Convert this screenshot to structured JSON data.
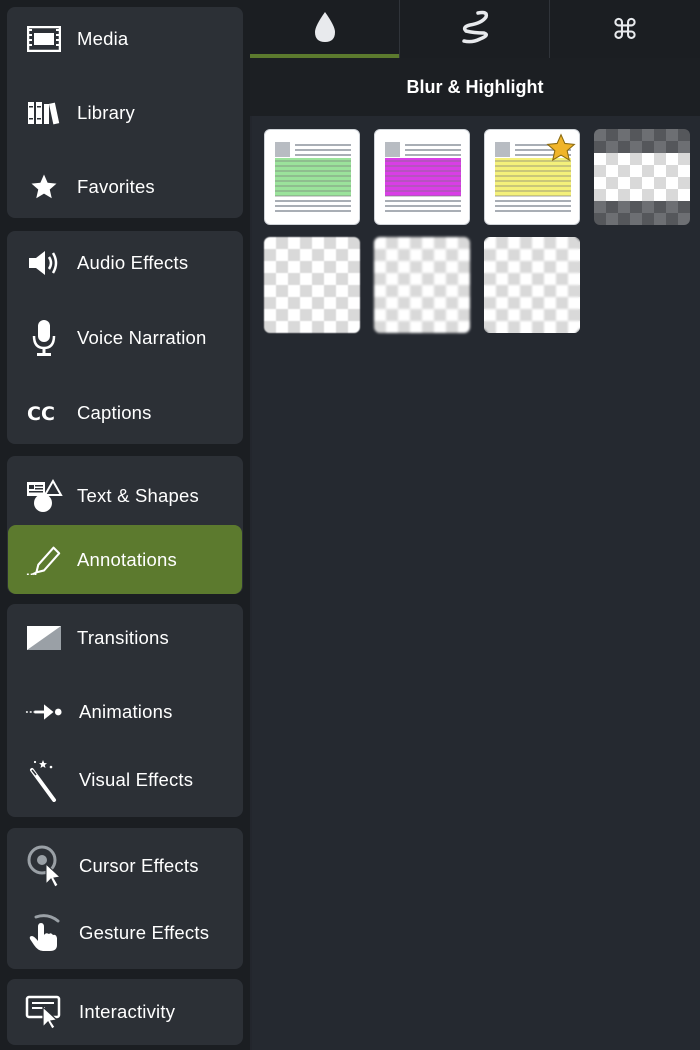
{
  "sidebar": {
    "items": [
      {
        "label": "Media",
        "icon": "film-strip-icon"
      },
      {
        "label": "Library",
        "icon": "books-icon"
      },
      {
        "label": "Favorites",
        "icon": "star-icon"
      },
      {
        "label": "Audio Effects",
        "icon": "speaker-icon"
      },
      {
        "label": "Voice Narration",
        "icon": "microphone-icon"
      },
      {
        "label": "Captions",
        "icon": "cc-icon"
      },
      {
        "label": "Text & Shapes",
        "icon": "text-shapes-icon"
      },
      {
        "label": "Annotations",
        "icon": "pen-annotation-icon",
        "active": true
      },
      {
        "label": "Transitions",
        "icon": "transition-icon"
      },
      {
        "label": "Animations",
        "icon": "arrow-animation-icon"
      },
      {
        "label": "Visual Effects",
        "icon": "magic-wand-icon"
      },
      {
        "label": "Cursor Effects",
        "icon": "cursor-target-icon"
      },
      {
        "label": "Gesture Effects",
        "icon": "hand-gesture-icon"
      },
      {
        "label": "Interactivity",
        "icon": "screen-cursor-icon"
      }
    ]
  },
  "tabs": [
    {
      "icon": "drop-icon",
      "active": true
    },
    {
      "icon": "squiggle-icon",
      "active": false
    },
    {
      "icon": "command-key-icon",
      "glyph": "⌘",
      "active": false
    }
  ],
  "section": {
    "title": "Blur & Highlight"
  },
  "presets": [
    {
      "kind": "highlight",
      "color": "#9be39b"
    },
    {
      "kind": "highlight",
      "color": "#d93ee6"
    },
    {
      "kind": "highlight",
      "color": "#f4f07a",
      "favorite": true
    },
    {
      "kind": "spotlight"
    },
    {
      "kind": "blur"
    },
    {
      "kind": "blur"
    },
    {
      "kind": "blur"
    }
  ],
  "colors": {
    "accent": "#5c7a2e",
    "star": "#f0b429",
    "panel": "#23262d",
    "sidebar_group": "#2c3036"
  }
}
